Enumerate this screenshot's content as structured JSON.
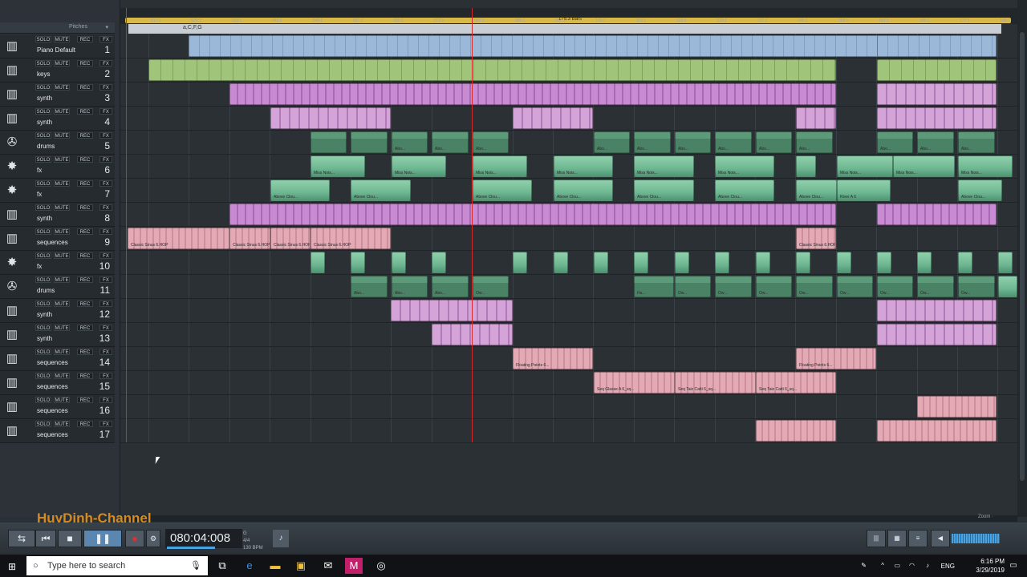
{
  "arranger": {
    "header_label": "Pitches",
    "header_arrow": "▾",
    "loop_length": "176.3 Bars",
    "chord_text": "a,C,F,G",
    "ruler_ticks": [
      "017:1",
      "025:1",
      "033:1",
      "041:1",
      "049:1",
      "057:1",
      "065:1",
      "073:1",
      "081:1",
      "089:1",
      "097:1",
      "105:1",
      "113:1",
      "121:1",
      "129:1",
      "137:1",
      "145:1",
      "153:1",
      "161:1",
      "169:1",
      "177:1",
      "185:1"
    ],
    "zoom_label": "Zoom ·"
  },
  "track_buttons": {
    "solo": "SOLO",
    "mute": "MUTE",
    "rec": "REC",
    "fx": "FX"
  },
  "tracks": [
    {
      "num": "1",
      "name": "Piano Default",
      "icon": "piano-icon"
    },
    {
      "num": "2",
      "name": "keys",
      "icon": "keyboard-icon"
    },
    {
      "num": "3",
      "name": "synth",
      "icon": "keyboard-icon"
    },
    {
      "num": "4",
      "name": "synth",
      "icon": "keyboard-icon"
    },
    {
      "num": "5",
      "name": "drums",
      "icon": "drums-icon"
    },
    {
      "num": "6",
      "name": "fx",
      "icon": "fx-icon"
    },
    {
      "num": "7",
      "name": "fx",
      "icon": "fx-icon"
    },
    {
      "num": "8",
      "name": "synth",
      "icon": "keyboard-icon"
    },
    {
      "num": "9",
      "name": "sequences",
      "icon": "keyboard-icon"
    },
    {
      "num": "10",
      "name": "fx",
      "icon": "fx-icon"
    },
    {
      "num": "11",
      "name": "drums",
      "icon": "drums-icon"
    },
    {
      "num": "12",
      "name": "synth",
      "icon": "keyboard-icon"
    },
    {
      "num": "13",
      "name": "synth",
      "icon": "keyboard-icon"
    },
    {
      "num": "14",
      "name": "sequences",
      "icon": "keyboard-icon"
    },
    {
      "num": "15",
      "name": "sequences",
      "icon": "keyboard-icon"
    },
    {
      "num": "16",
      "name": "sequences",
      "icon": "keyboard-icon"
    },
    {
      "num": "17",
      "name": "sequences",
      "icon": "keyboard-icon"
    }
  ],
  "clip_labels": {
    "drums": "Abo...",
    "miss_noise": "Miss Nois...",
    "above_clouds": "Above Clou...",
    "river": "River A 6",
    "classic": "Classic Sinus 6.HOP",
    "floating": "Floating Points 6...",
    "seq_glasse": "Seq Glasse A 6_sq...",
    "seq_taiz": "Seq Taiz Catti 6_sq...",
    "owl": "Ow...",
    "ha": "Ha..."
  },
  "transport": {
    "time": "080:04:008",
    "meter_top": "4/4",
    "meter_bottom": "130 BPM",
    "meter_label": "G"
  },
  "watermark": "HuyDinh-Channel",
  "taskbar": {
    "search_placeholder": "Type here to search",
    "language": "ENG",
    "time": "6:16 PM",
    "date": "3/29/2019"
  },
  "colors": {
    "playhead": "#d32a2a",
    "loop_bar": "#d9b84a",
    "watermark": "#d68b1e",
    "green_clip": "#9fc47a",
    "purple_clip": "#c88ad0",
    "teal_clip": "#5d9a7a",
    "pink_clip": "#e3a9b4"
  }
}
